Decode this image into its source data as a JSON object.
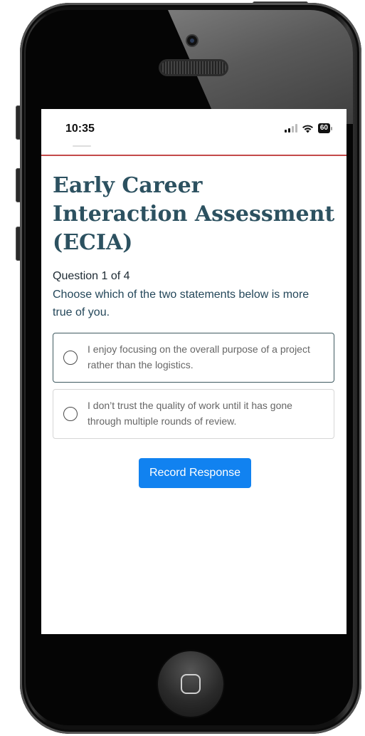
{
  "status_bar": {
    "time": "10:35",
    "battery_level": "60",
    "icons": [
      "cellular-signal-icon",
      "wifi-icon",
      "battery-icon"
    ]
  },
  "assessment": {
    "title": "Early Career Interaction Assessment (ECIA)",
    "question_count": "Question 1 of 4",
    "prompt": "Choose which of the two statements below is more true of you.",
    "options": [
      {
        "text": "I enjoy focusing on the overall purpose of a project rather than the logistics.",
        "selected": false
      },
      {
        "text": "I don’t trust the quality of work until it has gone through multiple rounds of review.",
        "selected": false
      }
    ],
    "submit_label": "Record Response"
  },
  "colors": {
    "title": "#2c5160",
    "prompt": "#24475a",
    "button": "#1182f0",
    "header_rule": "#c44a4a"
  }
}
